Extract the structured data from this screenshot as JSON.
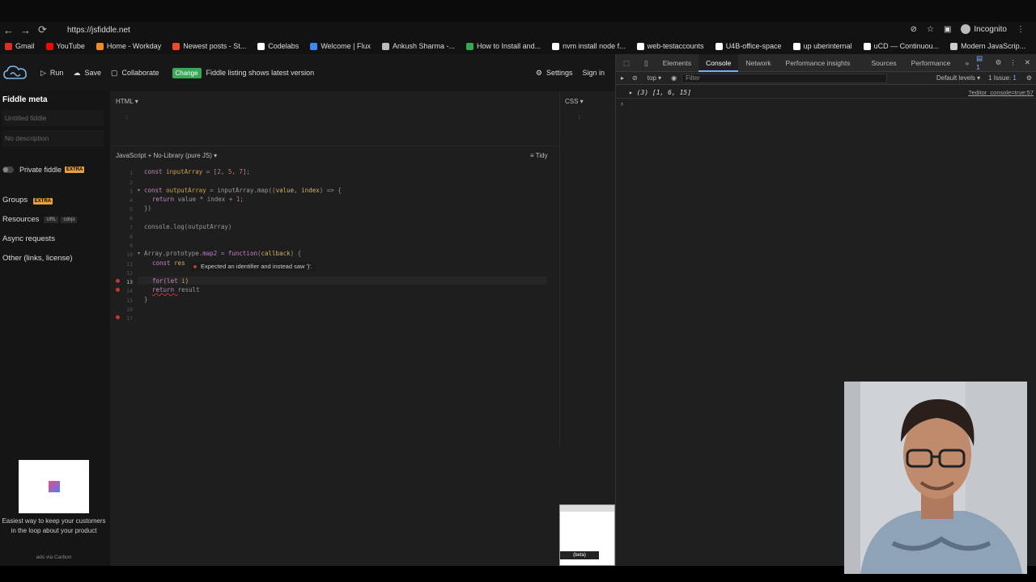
{
  "browser": {
    "url": "https://jsfiddle.net",
    "profile": "Incognito",
    "bookmarks": [
      "Gmail",
      "YouTube",
      "Home - Workday",
      "Newest posts - St...",
      "Codelabs",
      "Welcome | Flux",
      "Ankush Sharma -...",
      "How to Install and...",
      "nvm install node f...",
      "web-testaccounts",
      "U4B-office-space",
      "up uberinternal",
      "uCD — Continuou...",
      "Modern JavaScrip..."
    ],
    "bookmark_colors": [
      "#d93025",
      "#ff0000",
      "#f28b22",
      "#ee4b2b",
      "#ffffff",
      "#4285f4",
      "#bbbbbb",
      "#34a853",
      "#ffffff",
      "#ffffff",
      "#ffffff",
      "#ffffff",
      "#ffffff",
      "#cccccc"
    ]
  },
  "fiddle": {
    "header": {
      "run": "Run",
      "save": "Save",
      "collaborate": "Collaborate",
      "change_badge": "Change",
      "change_text": "Fiddle listing shows latest version",
      "settings": "Settings",
      "signin": "Sign in"
    },
    "sidebar": {
      "meta_title": "Fiddle meta",
      "title_placeholder": "Untitled fiddle",
      "desc_placeholder": "No description",
      "private": "Private fiddle",
      "extra": "EXTRA",
      "groups": "Groups",
      "resources": "Resources",
      "url_tag": "URL",
      "cdnjs_tag": "cdnjs",
      "async": "Async requests",
      "other": "Other (links, license)",
      "ad_text": "Easiest way to keep your customers in the loop about your product",
      "ad_via": "ads via Carbon"
    },
    "panes": {
      "html_label": "HTML ▾",
      "css_label": "CSS ▾",
      "js_label": "JavaScript + No-Library (pure JS) ▾",
      "tidy": "Tidy",
      "html_line": "1",
      "css_line": "1"
    },
    "code": {
      "line1": [
        "const ",
        "inputArray",
        " = [",
        "2",
        ", ",
        "5",
        ", ",
        "7",
        "];"
      ],
      "line3": [
        "const ",
        "outputArray",
        " = inputArray.map((",
        "value",
        ", ",
        "index",
        ") => {"
      ],
      "line4": [
        "return ",
        "value",
        " * ",
        "index",
        " + ",
        "1",
        ";"
      ],
      "line5": "})",
      "line7": "console.log(outputArray)",
      "line10": [
        "Array.prototype.",
        "map2",
        " = ",
        "function",
        "(",
        "callback",
        ") {"
      ],
      "line11": [
        "const ",
        "res"
      ],
      "tooltip": "Expected an identifier and instead saw ')'.",
      "line13": [
        "for",
        "(let ",
        "i",
        ")"
      ],
      "line14": [
        "return ",
        "result"
      ],
      "line15": "}",
      "line_numbers": [
        "1",
        "2",
        "3",
        "4",
        "5",
        "6",
        "7",
        "8",
        "9",
        "10",
        "11",
        "12",
        "13",
        "14",
        "15",
        "16",
        "17"
      ]
    },
    "beta": "(beta)"
  },
  "devtools": {
    "tabs": [
      "Elements",
      "Console",
      "Network",
      "Performance insights ⚠",
      "Sources",
      "Performance",
      "»"
    ],
    "active_tab": "Console",
    "badge": "1",
    "context": "top ▾",
    "filter_placeholder": "Filter",
    "levels": "Default levels ▾",
    "issues": "1 Issue:",
    "issue_count": "1",
    "log_output": "▸ (3) [1, 6, 15]",
    "log_source": "?editor_console=true:57",
    "prompt": "›"
  }
}
